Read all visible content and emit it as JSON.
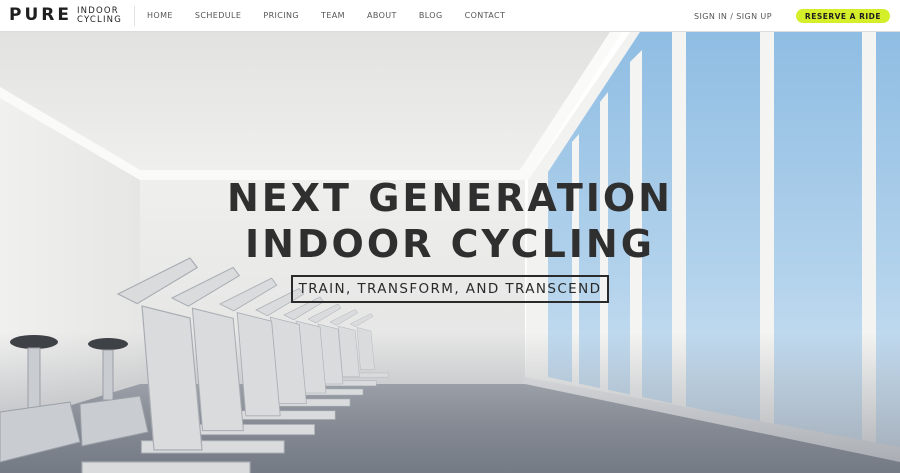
{
  "brand": {
    "name": "PURE",
    "line1": "INDOOR",
    "line2": "CYCLING"
  },
  "nav": {
    "items": [
      {
        "label": "HOME"
      },
      {
        "label": "SCHEDULE"
      },
      {
        "label": "PRICING"
      },
      {
        "label": "TEAM"
      },
      {
        "label": "ABOUT"
      },
      {
        "label": "BLOG"
      },
      {
        "label": "CONTACT"
      }
    ],
    "signin": "SIGN IN / SIGN UP",
    "cta": "RESERVE A RIDE"
  },
  "hero": {
    "headline_line1": "NEXT GENERATION",
    "headline_line2": "INDOOR CYCLING",
    "tagline": "TRAIN, TRANSFORM, AND TRANSCEND"
  },
  "colors": {
    "accent": "#d4ef2a",
    "text_dark": "#2f2f2f",
    "nav_text": "#555555",
    "sky": "#a9cdea",
    "wall": "#ececea"
  }
}
